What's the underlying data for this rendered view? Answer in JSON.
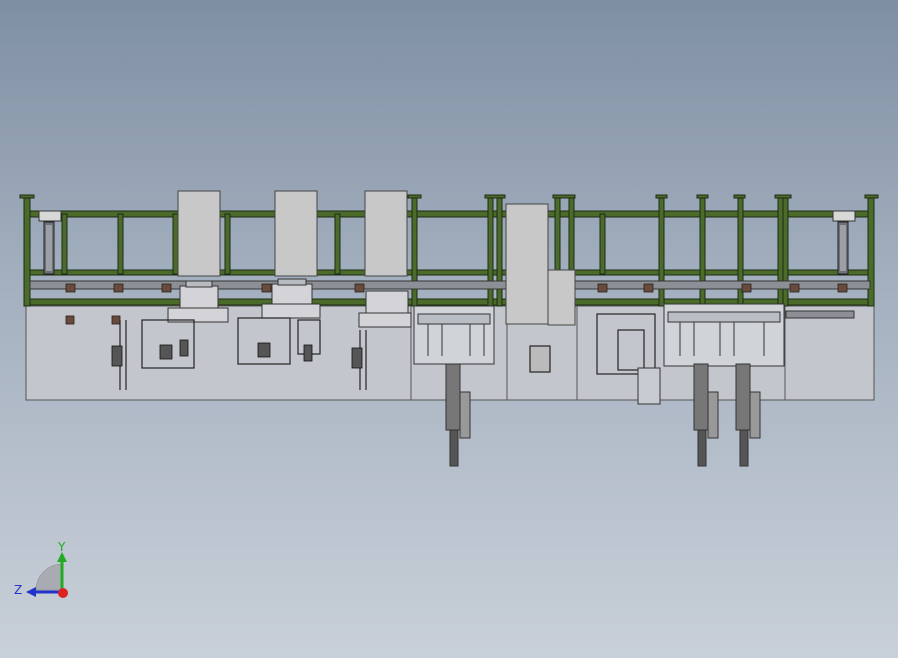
{
  "view": {
    "background_top": "#7f8fa3",
    "background_bottom": "#c9d0d9"
  },
  "triad": {
    "x_label": "",
    "y_label": "Y",
    "z_label": "Z",
    "y_color": "#22aa22",
    "z_color": "#2233cc",
    "origin_color": "#dd2222"
  },
  "colors": {
    "frame_green": "#4a6b2a",
    "frame_dark": "#1f2a14",
    "panel_gray": "#c4c8ce",
    "block_gray": "#c8c8c8",
    "steel": "#d4d4d8",
    "bolt_brown": "#6a4a3a"
  }
}
